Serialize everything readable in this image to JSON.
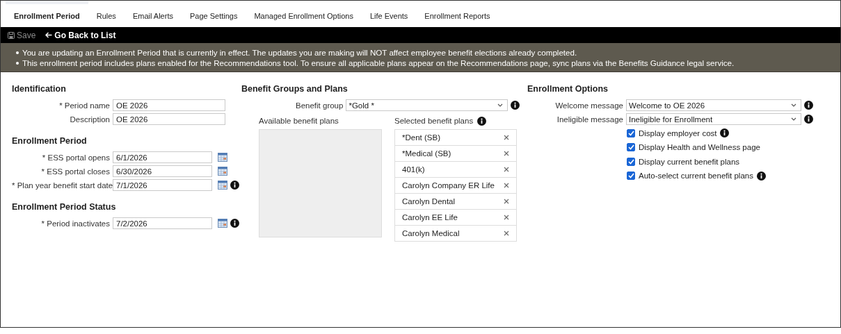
{
  "tabs": [
    {
      "label": "Enrollment Period",
      "selected": true
    },
    {
      "label": "Rules",
      "selected": false
    },
    {
      "label": "Email Alerts",
      "selected": false
    },
    {
      "label": "Page Settings",
      "selected": false
    },
    {
      "label": "Managed Enrollment Options",
      "selected": false
    },
    {
      "label": "Life Events",
      "selected": false
    },
    {
      "label": "Enrollment Reports",
      "selected": false
    }
  ],
  "toolbar": {
    "save": {
      "label": "Save",
      "disabled": true
    },
    "back": {
      "label": "Go Back to List"
    }
  },
  "notices": [
    "You are updating an Enrollment Period that is currently in effect. The updates you are making will NOT affect employee benefit elections already completed.",
    "This enrollment period includes plans enabled for the Recommendations tool. To ensure all applicable plans appear on the Recommendations page, sync plans via the Benefits Guidance legal service."
  ],
  "left_sections": [
    {
      "title": "Identification",
      "fields": [
        {
          "kind": "text",
          "label": "* Period name",
          "value": "OE 2026",
          "info": false
        },
        {
          "kind": "text",
          "label": "Description",
          "value": "OE 2026",
          "info": false
        }
      ]
    },
    {
      "title": "Enrollment Period",
      "fields": [
        {
          "kind": "date",
          "label": "* ESS portal opens",
          "value": "6/1/2026",
          "info": false
        },
        {
          "kind": "date",
          "label": "* ESS portal closes",
          "value": "6/30/2026",
          "info": false
        },
        {
          "kind": "date",
          "label": "* Plan year benefit start date",
          "value": "7/1/2026",
          "info": true
        }
      ]
    },
    {
      "title": "Enrollment Period Status",
      "fields": [
        {
          "kind": "date",
          "label": "* Period inactivates",
          "value": "7/2/2026",
          "info": true
        }
      ]
    }
  ],
  "benefit_groups": {
    "title": "Benefit Groups and Plans",
    "group": {
      "label": "Benefit group",
      "value": "*Gold *",
      "info": true
    },
    "available": {
      "label": "Available benefit plans"
    },
    "selected": {
      "label": "Selected benefit plans",
      "info": true,
      "items": [
        "*Dent (SB)",
        "*Medical (SB)",
        "401(k)",
        "Carolyn Company ER Life",
        "Carolyn Dental",
        "Carolyn EE Life",
        "Carolyn Medical"
      ]
    }
  },
  "enrollment_options": {
    "title": "Enrollment Options",
    "selects": [
      {
        "label": "Welcome message",
        "value": "Welcome to OE 2026",
        "info": true
      },
      {
        "label": "Ineligible message",
        "value": "Ineligible for Enrollment",
        "info": true
      }
    ],
    "checkboxes": [
      {
        "label": "Display employer cost",
        "checked": true,
        "info": true
      },
      {
        "label": "Display Health and Wellness page",
        "checked": true,
        "info": false
      },
      {
        "label": "Display current benefit plans",
        "checked": true,
        "info": false
      },
      {
        "label": "Auto-select current benefit plans",
        "checked": true,
        "info": true
      }
    ]
  }
}
